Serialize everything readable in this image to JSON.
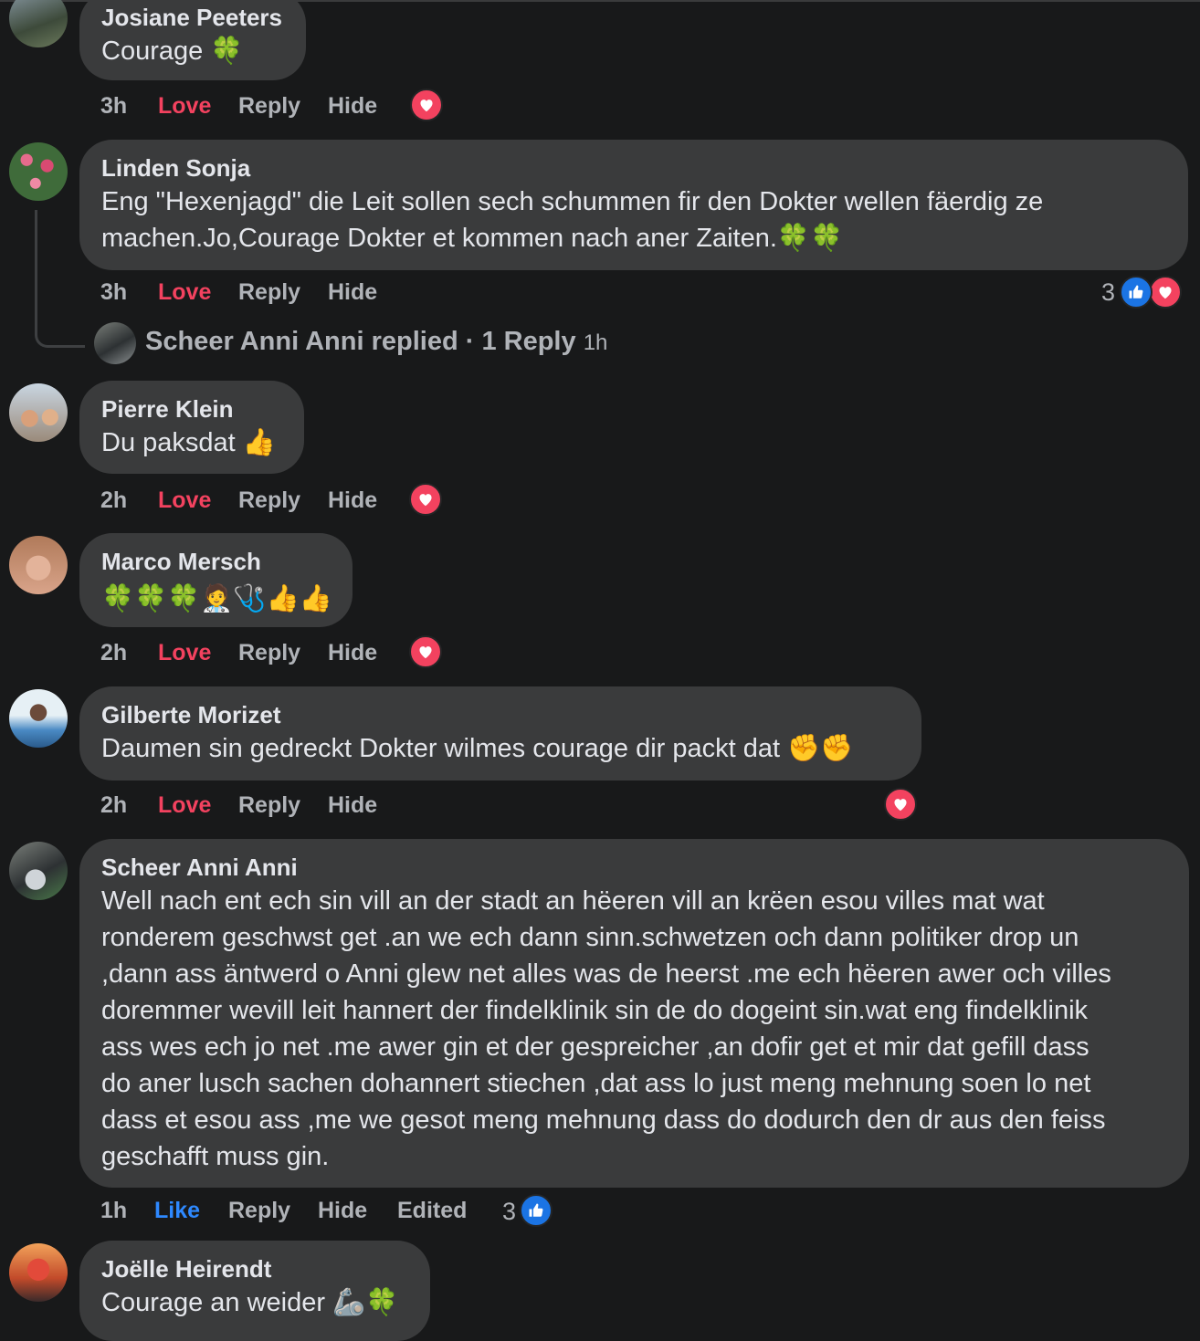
{
  "comments": [
    {
      "author": "Josiane Peeters",
      "text": "Courage 🍀",
      "time": "3h",
      "action_react": "Love",
      "reply": "Reply",
      "hide": "Hide"
    },
    {
      "author": "Linden Sonja",
      "text_line1": "Eng \"Hexenjagd\" die Leit sollen sech schummen fir den Dokter wellen fäerdig ze",
      "text_line2": "machen.Jo,Courage Dokter et kommen nach aner Zaiten.🍀🍀",
      "time": "3h",
      "action_react": "Love",
      "reply": "Reply",
      "hide": "Hide",
      "reaction_count": "3",
      "replies_summary": "Scheer Anni Anni replied · 1 Reply",
      "replies_time": "1h"
    },
    {
      "author": "Pierre Klein",
      "text": "Du paksdat 👍",
      "time": "2h",
      "action_react": "Love",
      "reply": "Reply",
      "hide": "Hide"
    },
    {
      "author": "Marco Mersch",
      "text": "🍀🍀🍀🧑‍⚕️🩺👍👍",
      "time": "2h",
      "action_react": "Love",
      "reply": "Reply",
      "hide": "Hide"
    },
    {
      "author": "Gilberte Morizet",
      "text": "Daumen sin gedreckt Dokter wilmes courage dir packt dat ✊✊",
      "time": "2h",
      "action_react": "Love",
      "reply": "Reply",
      "hide": "Hide"
    },
    {
      "author": "Scheer Anni Anni",
      "lines": [
        "Well nach ent ech sin vill an der stadt an hëeren vill an krëen esou villes mat wat",
        "ronderem geschwst get .an we ech dann sinn.schwetzen och dann politiker drop un",
        ",dann ass äntwerd o Anni glew net alles was de heerst .me ech hëeren awer och villes",
        "doremmer wevill leit hannert der findelklinik sin de do dogeint sin.wat eng findelklinik",
        "ass wes ech jo net .me awer gin et der gespreicher ,an dofir get et mir dat gefill dass",
        "do aner lusch sachen dohannert stiechen ,dat ass lo just meng mehnung soen lo net",
        "dass et esou ass ,me we gesot meng mehnung dass do dodurch den dr aus den feiss",
        "geschafft muss gin."
      ],
      "time": "1h",
      "action_react": "Like",
      "reply": "Reply",
      "hide": "Hide",
      "edited": "Edited",
      "reaction_count": "3"
    },
    {
      "author": "Joëlle Heirendt",
      "text": "Courage an weider 🦾🍀"
    }
  ],
  "colors": {
    "background": "#18191a",
    "bubble": "#3a3b3c",
    "love": "#f3425f",
    "like": "#2e89ff",
    "muted": "#b0b3b8"
  }
}
